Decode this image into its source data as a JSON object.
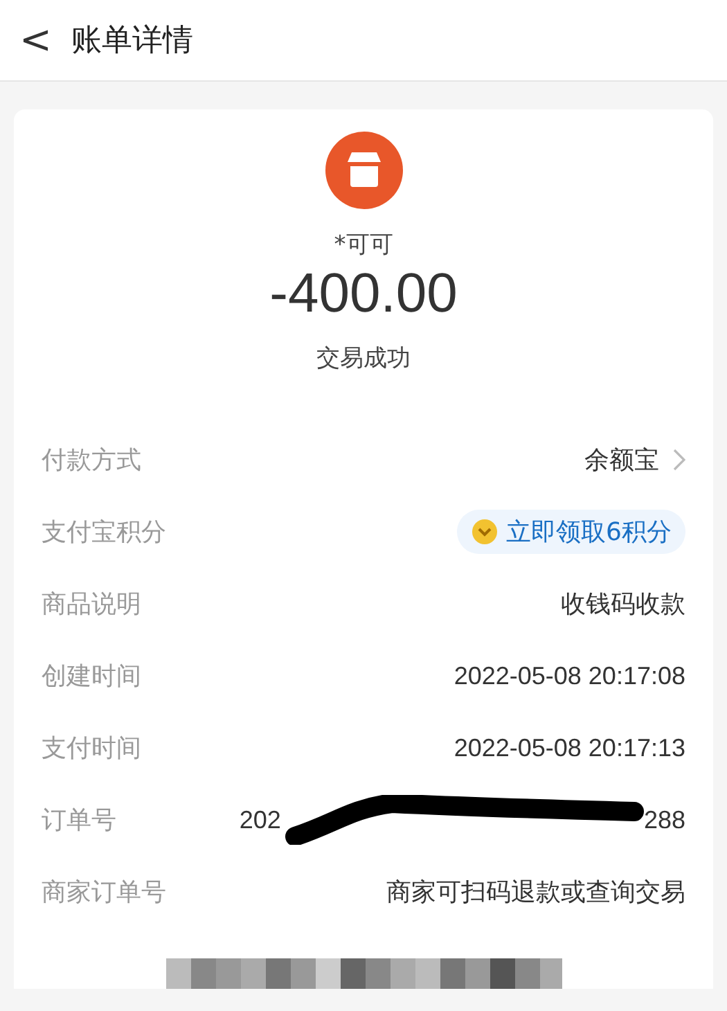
{
  "header": {
    "back": "<",
    "title": "账单详情"
  },
  "summary": {
    "payee": "*可可",
    "amount": "-400.00",
    "status": "交易成功"
  },
  "rows": [
    {
      "kind": "link",
      "label": "付款方式",
      "value": "余额宝"
    },
    {
      "kind": "badge",
      "label": "支付宝积分",
      "value": "立即领取6积分"
    },
    {
      "kind": "text",
      "label": "商品说明",
      "value": "收钱码收款"
    },
    {
      "kind": "text",
      "label": "创建时间",
      "value": "2022-05-08 20:17:08"
    },
    {
      "kind": "text",
      "label": "支付时间",
      "value": "2022-05-08 20:17:13"
    },
    {
      "kind": "redacted",
      "label": "订单号",
      "value_start": "202",
      "value_end": "288"
    },
    {
      "kind": "text",
      "label": "商家订单号",
      "value": "商家可扫码退款或查询交易"
    }
  ]
}
